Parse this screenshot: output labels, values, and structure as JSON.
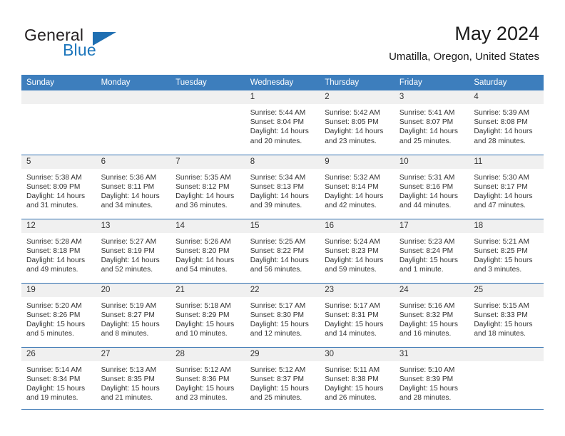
{
  "brand": {
    "name_part1": "General",
    "name_part2": "Blue",
    "logo_icon": "triangle-icon"
  },
  "header": {
    "title": "May 2024",
    "location": "Umatilla, Oregon, United States"
  },
  "calendar": {
    "weekday_headers": [
      "Sunday",
      "Monday",
      "Tuesday",
      "Wednesday",
      "Thursday",
      "Friday",
      "Saturday"
    ],
    "accent_color": "#3d7ebd",
    "rule_color": "#2f6fb0",
    "daynum_band_color": "#f0f0f0",
    "weeks": [
      [
        {
          "day": "",
          "sunrise": "",
          "sunset": "",
          "daylight_line1": "",
          "daylight_line2": ""
        },
        {
          "day": "",
          "sunrise": "",
          "sunset": "",
          "daylight_line1": "",
          "daylight_line2": ""
        },
        {
          "day": "",
          "sunrise": "",
          "sunset": "",
          "daylight_line1": "",
          "daylight_line2": ""
        },
        {
          "day": "1",
          "sunrise": "Sunrise: 5:44 AM",
          "sunset": "Sunset: 8:04 PM",
          "daylight_line1": "Daylight: 14 hours",
          "daylight_line2": "and 20 minutes."
        },
        {
          "day": "2",
          "sunrise": "Sunrise: 5:42 AM",
          "sunset": "Sunset: 8:05 PM",
          "daylight_line1": "Daylight: 14 hours",
          "daylight_line2": "and 23 minutes."
        },
        {
          "day": "3",
          "sunrise": "Sunrise: 5:41 AM",
          "sunset": "Sunset: 8:07 PM",
          "daylight_line1": "Daylight: 14 hours",
          "daylight_line2": "and 25 minutes."
        },
        {
          "day": "4",
          "sunrise": "Sunrise: 5:39 AM",
          "sunset": "Sunset: 8:08 PM",
          "daylight_line1": "Daylight: 14 hours",
          "daylight_line2": "and 28 minutes."
        }
      ],
      [
        {
          "day": "5",
          "sunrise": "Sunrise: 5:38 AM",
          "sunset": "Sunset: 8:09 PM",
          "daylight_line1": "Daylight: 14 hours",
          "daylight_line2": "and 31 minutes."
        },
        {
          "day": "6",
          "sunrise": "Sunrise: 5:36 AM",
          "sunset": "Sunset: 8:11 PM",
          "daylight_line1": "Daylight: 14 hours",
          "daylight_line2": "and 34 minutes."
        },
        {
          "day": "7",
          "sunrise": "Sunrise: 5:35 AM",
          "sunset": "Sunset: 8:12 PM",
          "daylight_line1": "Daylight: 14 hours",
          "daylight_line2": "and 36 minutes."
        },
        {
          "day": "8",
          "sunrise": "Sunrise: 5:34 AM",
          "sunset": "Sunset: 8:13 PM",
          "daylight_line1": "Daylight: 14 hours",
          "daylight_line2": "and 39 minutes."
        },
        {
          "day": "9",
          "sunrise": "Sunrise: 5:32 AM",
          "sunset": "Sunset: 8:14 PM",
          "daylight_line1": "Daylight: 14 hours",
          "daylight_line2": "and 42 minutes."
        },
        {
          "day": "10",
          "sunrise": "Sunrise: 5:31 AM",
          "sunset": "Sunset: 8:16 PM",
          "daylight_line1": "Daylight: 14 hours",
          "daylight_line2": "and 44 minutes."
        },
        {
          "day": "11",
          "sunrise": "Sunrise: 5:30 AM",
          "sunset": "Sunset: 8:17 PM",
          "daylight_line1": "Daylight: 14 hours",
          "daylight_line2": "and 47 minutes."
        }
      ],
      [
        {
          "day": "12",
          "sunrise": "Sunrise: 5:28 AM",
          "sunset": "Sunset: 8:18 PM",
          "daylight_line1": "Daylight: 14 hours",
          "daylight_line2": "and 49 minutes."
        },
        {
          "day": "13",
          "sunrise": "Sunrise: 5:27 AM",
          "sunset": "Sunset: 8:19 PM",
          "daylight_line1": "Daylight: 14 hours",
          "daylight_line2": "and 52 minutes."
        },
        {
          "day": "14",
          "sunrise": "Sunrise: 5:26 AM",
          "sunset": "Sunset: 8:20 PM",
          "daylight_line1": "Daylight: 14 hours",
          "daylight_line2": "and 54 minutes."
        },
        {
          "day": "15",
          "sunrise": "Sunrise: 5:25 AM",
          "sunset": "Sunset: 8:22 PM",
          "daylight_line1": "Daylight: 14 hours",
          "daylight_line2": "and 56 minutes."
        },
        {
          "day": "16",
          "sunrise": "Sunrise: 5:24 AM",
          "sunset": "Sunset: 8:23 PM",
          "daylight_line1": "Daylight: 14 hours",
          "daylight_line2": "and 59 minutes."
        },
        {
          "day": "17",
          "sunrise": "Sunrise: 5:23 AM",
          "sunset": "Sunset: 8:24 PM",
          "daylight_line1": "Daylight: 15 hours",
          "daylight_line2": "and 1 minute."
        },
        {
          "day": "18",
          "sunrise": "Sunrise: 5:21 AM",
          "sunset": "Sunset: 8:25 PM",
          "daylight_line1": "Daylight: 15 hours",
          "daylight_line2": "and 3 minutes."
        }
      ],
      [
        {
          "day": "19",
          "sunrise": "Sunrise: 5:20 AM",
          "sunset": "Sunset: 8:26 PM",
          "daylight_line1": "Daylight: 15 hours",
          "daylight_line2": "and 5 minutes."
        },
        {
          "day": "20",
          "sunrise": "Sunrise: 5:19 AM",
          "sunset": "Sunset: 8:27 PM",
          "daylight_line1": "Daylight: 15 hours",
          "daylight_line2": "and 8 minutes."
        },
        {
          "day": "21",
          "sunrise": "Sunrise: 5:18 AM",
          "sunset": "Sunset: 8:29 PM",
          "daylight_line1": "Daylight: 15 hours",
          "daylight_line2": "and 10 minutes."
        },
        {
          "day": "22",
          "sunrise": "Sunrise: 5:17 AM",
          "sunset": "Sunset: 8:30 PM",
          "daylight_line1": "Daylight: 15 hours",
          "daylight_line2": "and 12 minutes."
        },
        {
          "day": "23",
          "sunrise": "Sunrise: 5:17 AM",
          "sunset": "Sunset: 8:31 PM",
          "daylight_line1": "Daylight: 15 hours",
          "daylight_line2": "and 14 minutes."
        },
        {
          "day": "24",
          "sunrise": "Sunrise: 5:16 AM",
          "sunset": "Sunset: 8:32 PM",
          "daylight_line1": "Daylight: 15 hours",
          "daylight_line2": "and 16 minutes."
        },
        {
          "day": "25",
          "sunrise": "Sunrise: 5:15 AM",
          "sunset": "Sunset: 8:33 PM",
          "daylight_line1": "Daylight: 15 hours",
          "daylight_line2": "and 18 minutes."
        }
      ],
      [
        {
          "day": "26",
          "sunrise": "Sunrise: 5:14 AM",
          "sunset": "Sunset: 8:34 PM",
          "daylight_line1": "Daylight: 15 hours",
          "daylight_line2": "and 19 minutes."
        },
        {
          "day": "27",
          "sunrise": "Sunrise: 5:13 AM",
          "sunset": "Sunset: 8:35 PM",
          "daylight_line1": "Daylight: 15 hours",
          "daylight_line2": "and 21 minutes."
        },
        {
          "day": "28",
          "sunrise": "Sunrise: 5:12 AM",
          "sunset": "Sunset: 8:36 PM",
          "daylight_line1": "Daylight: 15 hours",
          "daylight_line2": "and 23 minutes."
        },
        {
          "day": "29",
          "sunrise": "Sunrise: 5:12 AM",
          "sunset": "Sunset: 8:37 PM",
          "daylight_line1": "Daylight: 15 hours",
          "daylight_line2": "and 25 minutes."
        },
        {
          "day": "30",
          "sunrise": "Sunrise: 5:11 AM",
          "sunset": "Sunset: 8:38 PM",
          "daylight_line1": "Daylight: 15 hours",
          "daylight_line2": "and 26 minutes."
        },
        {
          "day": "31",
          "sunrise": "Sunrise: 5:10 AM",
          "sunset": "Sunset: 8:39 PM",
          "daylight_line1": "Daylight: 15 hours",
          "daylight_line2": "and 28 minutes."
        },
        {
          "day": "",
          "sunrise": "",
          "sunset": "",
          "daylight_line1": "",
          "daylight_line2": ""
        }
      ]
    ]
  }
}
